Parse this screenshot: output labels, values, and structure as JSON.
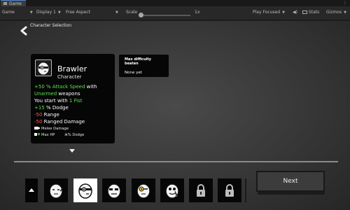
{
  "window": {
    "tab_title": "Game",
    "toolbar": {
      "display_mode": "Game",
      "display": "Display 1",
      "aspect": "Free Aspect",
      "scale_label": "Scale",
      "scale_value": "1x",
      "play_mode": "Play Focused",
      "stats_label": "Stats",
      "gizmos_label": "Gizmos"
    }
  },
  "screen": {
    "title": "Character Selection",
    "character": {
      "name": "Brawler",
      "class": "Character",
      "line1_value": "+50",
      "line1_stat": "% Attack Speed",
      "line1_tail": "with",
      "line2_highlight": "Unarmed",
      "line2_tail": "weapons",
      "line3_head": "You start with",
      "line3_highlight": "1 Fist",
      "line4_value": "+15",
      "line4_stat": "% Dodge",
      "line5_value": "-50",
      "line5_stat": "Range",
      "line6_value": "-50",
      "line6_stat": "Ranged Damage",
      "tag1": "Melee Damage",
      "tag2a": "Max HP",
      "tag2b": "% Dodge"
    },
    "difficulty": {
      "heading": "Max difficulty beaten",
      "value": "None yet"
    },
    "next_label": "Next",
    "roster": [
      {
        "id": "char-1",
        "locked": false,
        "selected": false
      },
      {
        "id": "char-brawler",
        "locked": false,
        "selected": true
      },
      {
        "id": "char-3",
        "locked": false,
        "selected": false
      },
      {
        "id": "char-4",
        "locked": false,
        "selected": false
      },
      {
        "id": "char-5",
        "locked": false,
        "selected": false
      },
      {
        "id": "locked-1",
        "locked": true,
        "selected": false
      },
      {
        "id": "locked-2",
        "locked": true,
        "selected": false
      }
    ]
  },
  "colors": {
    "positive": "#5ee04e",
    "negative": "#ff5a4a",
    "panel_bg": "#060606",
    "selected_slot": "#ffffff"
  }
}
